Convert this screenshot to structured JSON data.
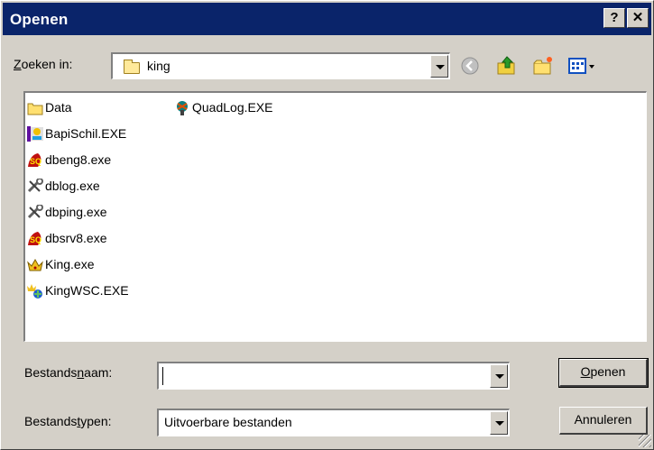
{
  "window": {
    "title": "Openen",
    "help_btn": "?",
    "close_btn": "✕"
  },
  "lookin": {
    "label_pre": "",
    "label_u": "Z",
    "label_post": "oeken in:",
    "value": "king"
  },
  "toolbar": {
    "back_icon": "back-icon",
    "up_icon": "up-folder-icon",
    "newfolder_icon": "new-folder-icon",
    "view_icon": "view-menu-icon"
  },
  "files": [
    {
      "name": "Data",
      "icon": "folder-icon"
    },
    {
      "name": "BapiSchil.EXE",
      "icon": "bapischil-icon"
    },
    {
      "name": "dbeng8.exe",
      "icon": "dbeng-icon"
    },
    {
      "name": "dblog.exe",
      "icon": "tools-icon"
    },
    {
      "name": "dbping.exe",
      "icon": "tools-icon"
    },
    {
      "name": "dbsrv8.exe",
      "icon": "dbsrv-icon"
    },
    {
      "name": "King.exe",
      "icon": "crown-icon"
    },
    {
      "name": "KingWSC.EXE",
      "icon": "kingwsc-icon"
    },
    {
      "name": "QuadLog.EXE",
      "icon": "quadlog-icon"
    }
  ],
  "filename": {
    "label_pre": "Bestands",
    "label_u": "n",
    "label_post": "aam:",
    "value": ""
  },
  "filetype": {
    "label_pre": "Bestands",
    "label_u": "t",
    "label_post": "ypen:",
    "value": "Uitvoerbare bestanden"
  },
  "buttons": {
    "open_u": "O",
    "open_rest": "penen",
    "cancel": "Annuleren"
  },
  "colors": {
    "titlebar": "#0a246a",
    "face": "#d4d0c8"
  }
}
